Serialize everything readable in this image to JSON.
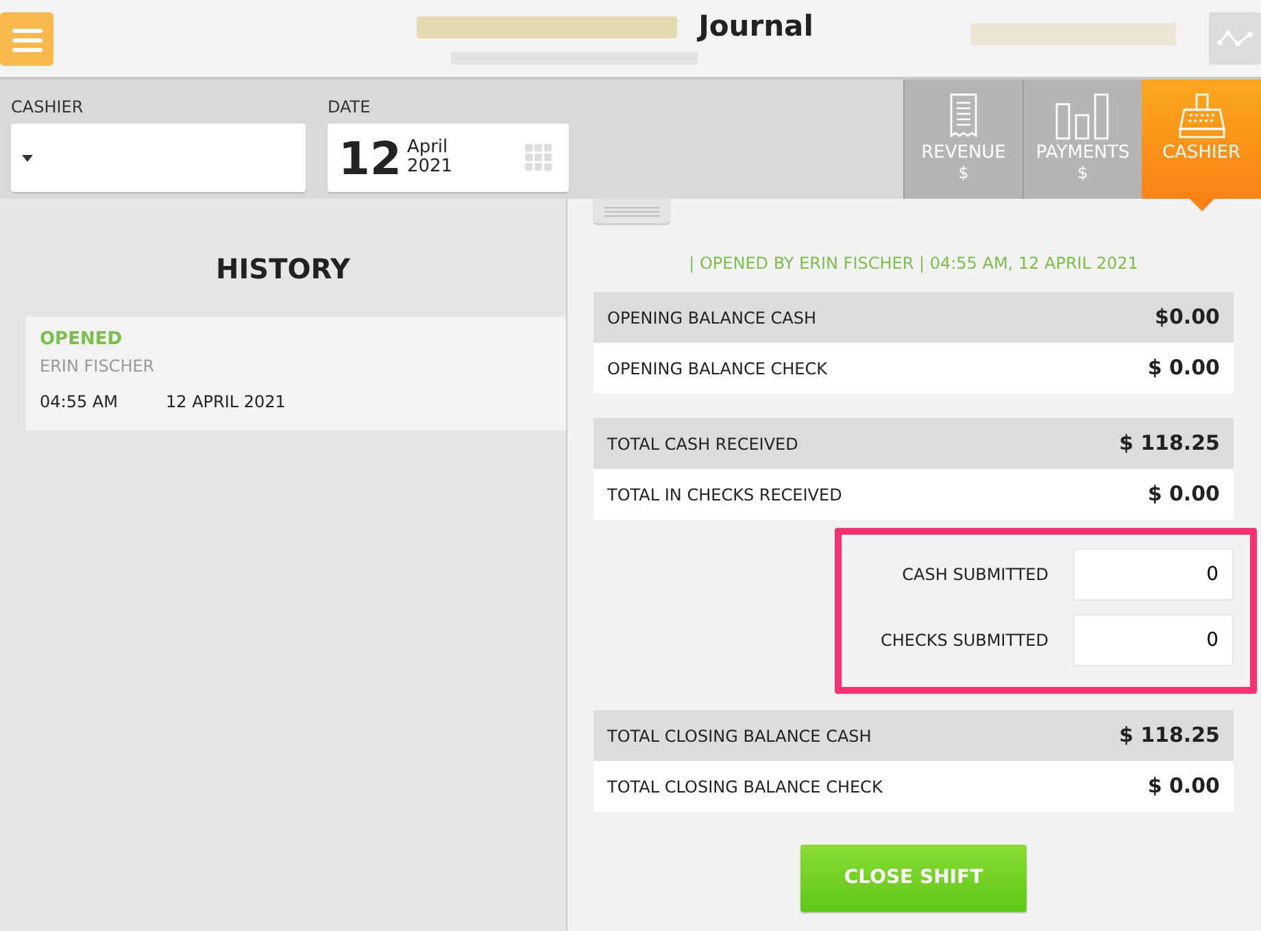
{
  "header": {
    "title": "Journal"
  },
  "filters": [
    {
      "label": "CASHIER",
      "kind": "select"
    },
    {
      "label": "DATE",
      "kind": "date",
      "day": "12",
      "month": "April",
      "year": "2021"
    }
  ],
  "tabs": [
    {
      "label": "REVENUE",
      "sub": "$",
      "kind": "receipt",
      "selected": false
    },
    {
      "label": "PAYMENTS",
      "sub": "$",
      "kind": "bars",
      "selected": false
    },
    {
      "label": "CASHIER",
      "kind": "register",
      "selected": true
    }
  ],
  "history": {
    "title": "HISTORY",
    "entries": [
      {
        "status": "OPENED",
        "name": "ERIN FISCHER",
        "time": "04:55 AM",
        "date": "12 APRIL 2021"
      }
    ]
  },
  "summary": {
    "opened_line": "| OPENED BY ERIN FISCHER | 04:55 AM, 12 APRIL 2021",
    "groups": [
      {
        "kind": "rows",
        "rows": [
          {
            "label": "OPENING BALANCE CASH",
            "value": "$0.00"
          },
          {
            "label": "OPENING BALANCE CHECK",
            "value": "$ 0.00"
          }
        ]
      },
      {
        "kind": "rows",
        "rows": [
          {
            "label": "TOTAL CASH RECEIVED",
            "value": "$ 118.25"
          },
          {
            "label": "TOTAL IN CHECKS RECEIVED",
            "value": "$ 0.00"
          }
        ]
      },
      {
        "kind": "fields",
        "highlighted": true,
        "fields": [
          {
            "label": "CASH SUBMITTED",
            "value": "0"
          },
          {
            "label": "CHECKS SUBMITTED",
            "value": "0"
          }
        ]
      },
      {
        "kind": "rows",
        "rows": [
          {
            "label": "TOTAL CLOSING BALANCE CASH",
            "value": "$ 118.25"
          },
          {
            "label": "TOTAL CLOSING BALANCE CHECK",
            "value": "$ 0.00"
          }
        ]
      }
    ],
    "button": "CLOSE SHIFT"
  }
}
